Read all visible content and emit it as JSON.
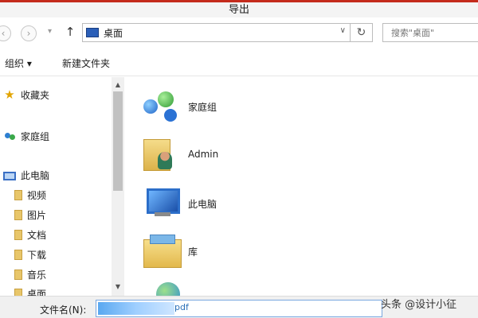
{
  "window": {
    "title": "导出"
  },
  "nav": {
    "back_icon": "back-arrow-icon",
    "forward_icon": "forward-arrow-icon",
    "up_icon": "up-arrow-icon",
    "address_text": "桌面",
    "refresh_icon": "refresh-icon",
    "search_placeholder": "搜索\"桌面\""
  },
  "toolbar": {
    "organize_label": "组织 ▾",
    "new_folder_label": "新建文件夹"
  },
  "sidebar": {
    "items": [
      {
        "label": "收藏夹",
        "icon": "star-icon"
      },
      {
        "label": "家庭组",
        "icon": "homegroup-icon"
      },
      {
        "label": "此电脑",
        "icon": "computer-icon"
      },
      {
        "label": "视频",
        "icon": "folder-icon"
      },
      {
        "label": "图片",
        "icon": "folder-icon"
      },
      {
        "label": "文档",
        "icon": "folder-icon"
      },
      {
        "label": "下载",
        "icon": "folder-icon"
      },
      {
        "label": "音乐",
        "icon": "folder-icon"
      },
      {
        "label": "桌面",
        "icon": "folder-icon"
      }
    ]
  },
  "content": {
    "items": [
      {
        "name": "家庭组",
        "icon": "homegroup-icon"
      },
      {
        "name": "Admin",
        "icon": "user-folder-icon"
      },
      {
        "name": "此电脑",
        "icon": "computer-icon"
      },
      {
        "name": "库",
        "icon": "library-icon"
      },
      {
        "name": "",
        "icon": "network-icon"
      }
    ]
  },
  "footer": {
    "filename_label": "文件名(N):",
    "filename_ext": "pdf"
  },
  "watermark": "头条 @设计小征",
  "colors": {
    "title_accent": "#c42b1c",
    "selection": "#5aa8f0"
  }
}
